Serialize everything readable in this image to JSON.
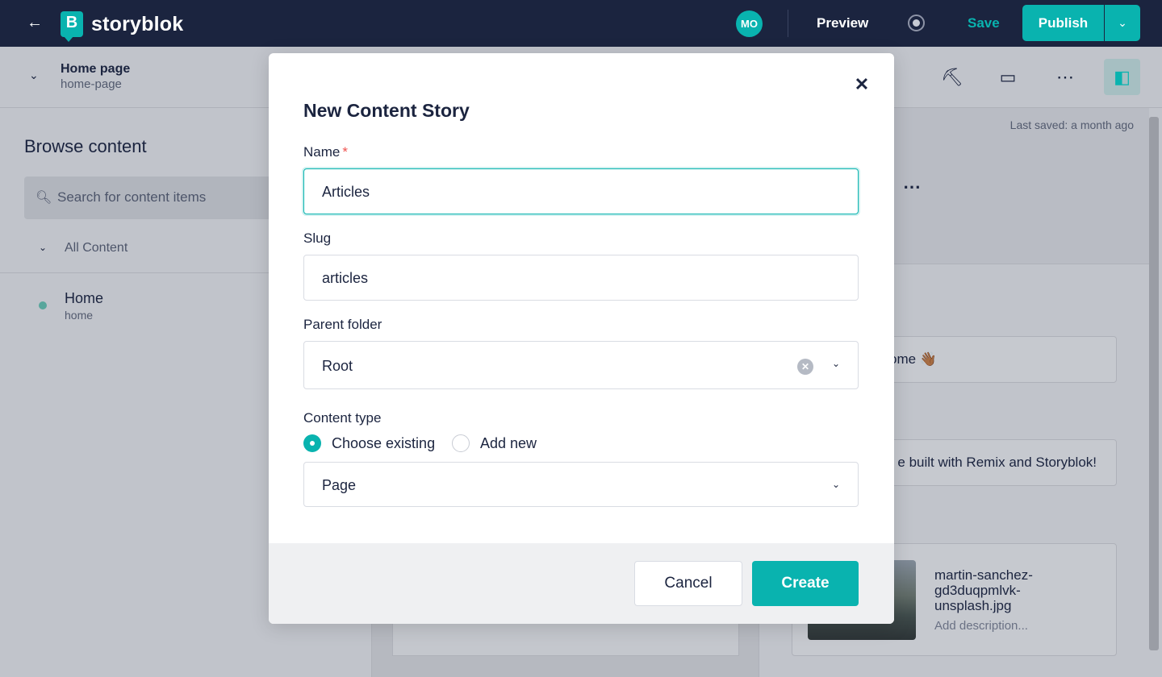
{
  "app": {
    "logo_text": "storyblok",
    "logo_glyph": "B",
    "avatar_initials": "MO",
    "preview_label": "Preview",
    "save_label": "Save",
    "publish_label": "Publish",
    "accent_color": "#09b3af",
    "topbar_color": "#1b243f"
  },
  "story": {
    "title": "Home page",
    "slug": "home-page",
    "last_saved": "Last saved: a month ago"
  },
  "sidebar": {
    "title": "Browse content",
    "search_placeholder": "Search for content items",
    "tree_root": "All Content",
    "items": [
      {
        "title": "Home",
        "slug": "home"
      }
    ]
  },
  "right_panel": {
    "field_1_text": "ome 👋🏾",
    "field_2_text": "e built with Remix and Storyblok!",
    "asset_name": "martin-sanchez-gd3duqpmlvk-unsplash.jpg",
    "asset_description_placeholder": "Add description..."
  },
  "modal": {
    "title": "New Content Story",
    "name_label": "Name",
    "required_mark": "*",
    "name_value": "Articles",
    "slug_label": "Slug",
    "slug_value": "articles",
    "parent_label": "Parent folder",
    "parent_value": "Root",
    "content_type_label": "Content type",
    "radio_existing": "Choose existing",
    "radio_new": "Add new",
    "content_type_value": "Page",
    "cancel_label": "Cancel",
    "create_label": "Create"
  }
}
